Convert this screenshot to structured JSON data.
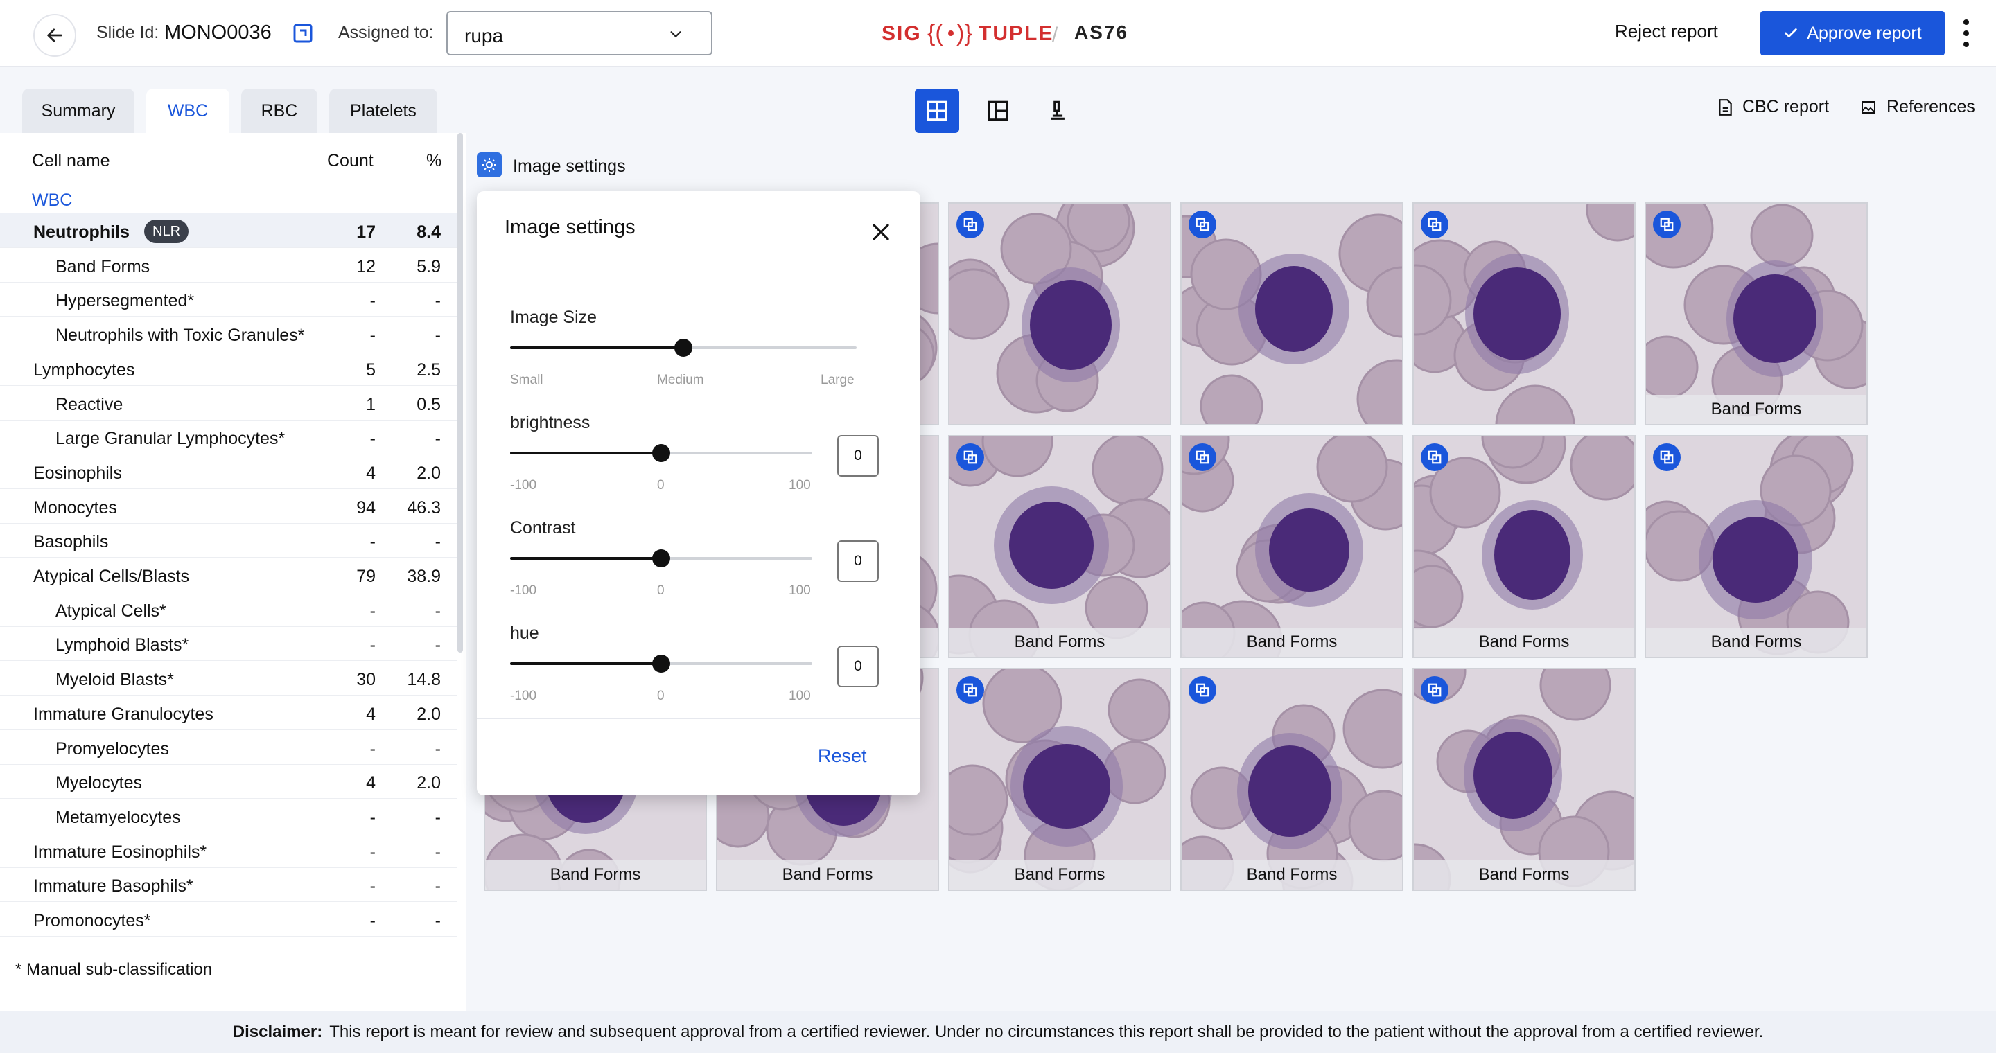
{
  "header": {
    "slide_label": "Slide Id:",
    "slide_id": "MONO0036",
    "assigned_label": "Assigned to:",
    "assigned_value": "rupa",
    "reject_label": "Reject report",
    "approve_label": "Approve report",
    "logo_text": "SIG{(·)}TUPLE",
    "product_text": "AS76"
  },
  "tabs": [
    {
      "label": "Summary",
      "active": false
    },
    {
      "label": "WBC",
      "active": true
    },
    {
      "label": "RBC",
      "active": false
    },
    {
      "label": "Platelets",
      "active": false
    }
  ],
  "view_buttons": [
    "grid-view-icon",
    "split-view-icon",
    "microscope-icon"
  ],
  "top_links": {
    "cbc": "CBC report",
    "references": "References"
  },
  "table": {
    "col_name": "Cell name",
    "col_count": "Count",
    "col_pct": "%",
    "group": "WBC",
    "nlr_badge": "NLR",
    "rows": [
      {
        "name": "Neutrophils",
        "count": "17",
        "pct": "8.4",
        "indent": 0,
        "bold": true
      },
      {
        "name": "Band Forms",
        "count": "12",
        "pct": "5.9",
        "indent": 1
      },
      {
        "name": "Hypersegmented*",
        "count": "-",
        "pct": "-",
        "indent": 1
      },
      {
        "name": "Neutrophils with Toxic Granules*",
        "count": "-",
        "pct": "-",
        "indent": 1
      },
      {
        "name": "Lymphocytes",
        "count": "5",
        "pct": "2.5",
        "indent": 0
      },
      {
        "name": "Reactive",
        "count": "1",
        "pct": "0.5",
        "indent": 1
      },
      {
        "name": "Large Granular Lymphocytes*",
        "count": "-",
        "pct": "-",
        "indent": 1
      },
      {
        "name": "Eosinophils",
        "count": "4",
        "pct": "2.0",
        "indent": 0
      },
      {
        "name": "Monocytes",
        "count": "94",
        "pct": "46.3",
        "indent": 0
      },
      {
        "name": "Basophils",
        "count": "-",
        "pct": "-",
        "indent": 0
      },
      {
        "name": "Atypical Cells/Blasts",
        "count": "79",
        "pct": "38.9",
        "indent": 0
      },
      {
        "name": "Atypical Cells*",
        "count": "-",
        "pct": "-",
        "indent": 1
      },
      {
        "name": "Lymphoid Blasts*",
        "count": "-",
        "pct": "-",
        "indent": 1
      },
      {
        "name": "Myeloid Blasts*",
        "count": "30",
        "pct": "14.8",
        "indent": 1
      },
      {
        "name": "Immature Granulocytes",
        "count": "4",
        "pct": "2.0",
        "indent": 0
      },
      {
        "name": "Promyelocytes",
        "count": "-",
        "pct": "-",
        "indent": 1
      },
      {
        "name": "Myelocytes",
        "count": "4",
        "pct": "2.0",
        "indent": 1
      },
      {
        "name": "Metamyelocytes",
        "count": "-",
        "pct": "-",
        "indent": 1
      },
      {
        "name": "Immature Eosinophils*",
        "count": "-",
        "pct": "-",
        "indent": 0
      },
      {
        "name": "Immature Basophils*",
        "count": "-",
        "pct": "-",
        "indent": 0
      },
      {
        "name": "Promonocytes*",
        "count": "-",
        "pct": "-",
        "indent": 0
      }
    ],
    "footnote": "* Manual sub-classification"
  },
  "image_settings_label": "Image settings",
  "tile_caption": "Band Forms",
  "popup": {
    "title": "Image settings",
    "image_size_label": "Image Size",
    "size_ticks": [
      "Small",
      "Medium",
      "Large"
    ],
    "image_size_level": 0.5,
    "sliders": [
      {
        "label": "brightness",
        "value": "0",
        "level": 0.5
      },
      {
        "label": "Contrast",
        "value": "0",
        "level": 0.5
      },
      {
        "label": "hue",
        "value": "0",
        "level": 0.5
      }
    ],
    "range_ticks": [
      "-100",
      "0",
      "100"
    ],
    "reset_label": "Reset"
  },
  "disclaimer": {
    "label": "Disclaimer:",
    "text": "This report is meant for review and subsequent approval from a certified reviewer. Under no circumstances this report shall be provided to the patient without the approval from a certified reviewer."
  },
  "colors": {
    "accent": "#1a56db",
    "cell_nucleus": "#4a2a78",
    "rbc": "#b9a6b8"
  }
}
